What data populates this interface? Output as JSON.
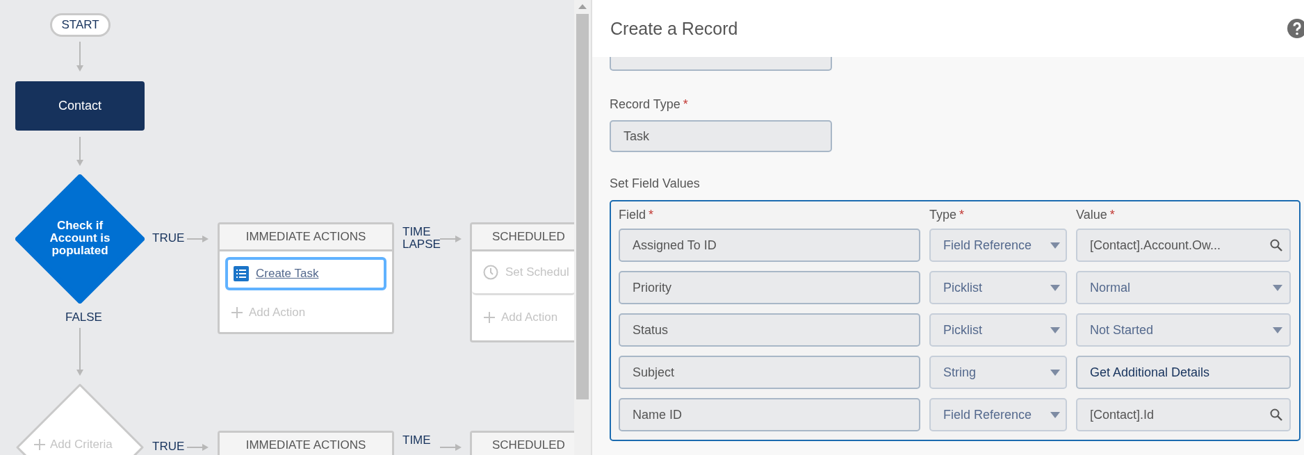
{
  "flow": {
    "start": "START",
    "object": "Contact",
    "criteria": [
      {
        "kind": "decision",
        "label": "Check if Account is populated",
        "true_label": "TRUE",
        "false_label": "FALSE",
        "immediate": {
          "title": "IMMEDIATE ACTIONS",
          "actions": [
            {
              "label": "Create Task",
              "selected": true
            }
          ],
          "add_label": "Add Action"
        },
        "time_lapse": "TIME LAPSE",
        "scheduled": {
          "title": "SCHEDULED",
          "actions": [
            {
              "label": "Set Schedul",
              "selected": false
            }
          ],
          "add_label": "Add Action"
        }
      },
      {
        "kind": "add",
        "label": "Add Criteria",
        "true_label": "TRUE",
        "immediate": {
          "title": "IMMEDIATE ACTIONS"
        },
        "time_lapse": "TIME",
        "scheduled": {
          "title": "SCHEDULED"
        }
      }
    ]
  },
  "panel": {
    "title": "Create a Record",
    "record_type": {
      "label": "Record Type",
      "required_mark": "*",
      "value": "Task"
    },
    "field_values": {
      "title": "Set Field Values",
      "columns": [
        {
          "label": "Field",
          "required_mark": "*"
        },
        {
          "label": "Type",
          "required_mark": "*"
        },
        {
          "label": "Value",
          "required_mark": "*"
        }
      ],
      "rows": [
        {
          "field": "Assigned To ID",
          "type": "Field Reference",
          "value": "[Contact].Account.Ow...",
          "kind": "lookup"
        },
        {
          "field": "Priority",
          "type": "Picklist",
          "value": "Normal",
          "kind": "picklist"
        },
        {
          "field": "Status",
          "type": "Picklist",
          "value": "Not Started",
          "kind": "picklist"
        },
        {
          "field": "Subject",
          "type": "String",
          "value": "Get Additional Details",
          "kind": "text"
        },
        {
          "field": "Name ID",
          "type": "Field Reference",
          "value": "[Contact].Id",
          "kind": "lookup"
        }
      ]
    }
  }
}
